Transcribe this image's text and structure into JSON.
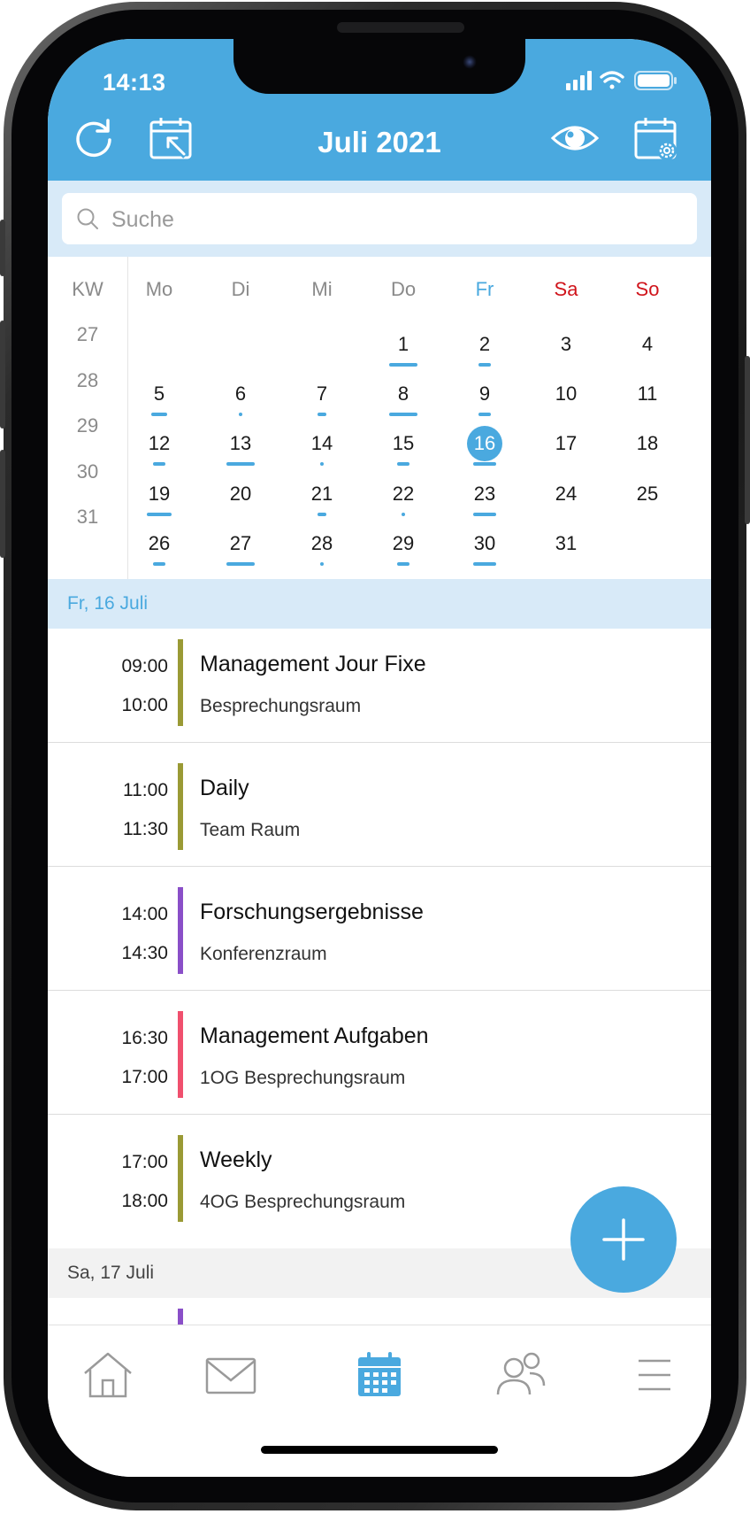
{
  "status_bar": {
    "time": "14:13"
  },
  "header": {
    "title": "Juli 2021"
  },
  "search": {
    "placeholder": "Suche"
  },
  "calendar": {
    "kw_label": "KW",
    "weekdays": [
      "Mo",
      "Di",
      "Mi",
      "Do",
      "Fr",
      "Sa",
      "So"
    ],
    "weeks": [
      {
        "kw": "27",
        "days": [
          "",
          "",
          "",
          "1",
          "2",
          "3",
          "4"
        ]
      },
      {
        "kw": "28",
        "days": [
          "5",
          "6",
          "7",
          "8",
          "9",
          "10",
          "11"
        ]
      },
      {
        "kw": "29",
        "days": [
          "12",
          "13",
          "14",
          "15",
          "16",
          "17",
          "18"
        ]
      },
      {
        "kw": "30",
        "days": [
          "19",
          "20",
          "21",
          "22",
          "23",
          "24",
          "25"
        ]
      },
      {
        "kw": "31",
        "days": [
          "26",
          "27",
          "28",
          "29",
          "30",
          "31",
          ""
        ]
      }
    ],
    "selected_day": "16"
  },
  "agenda": {
    "day1_label": "Fr, 16 Juli",
    "day2_label": "Sa, 17 Juli",
    "events": [
      {
        "start": "09:00",
        "end": "10:00",
        "title": "Management Jour Fixe",
        "location": "Besprechungsraum",
        "color": "#9a9a35"
      },
      {
        "start": "11:00",
        "end": "11:30",
        "title": "Daily",
        "location": "Team Raum",
        "color": "#9a9a35"
      },
      {
        "start": "14:00",
        "end": "14:30",
        "title": "Forschungsergebnisse",
        "location": "Konferenzraum",
        "color": "#8a4fc8"
      },
      {
        "start": "16:30",
        "end": "17:00",
        "title": "Management Aufgaben",
        "location": "1OG Besprechungsraum",
        "color": "#f0506e"
      },
      {
        "start": "17:00",
        "end": "18:00",
        "title": "Weekly",
        "location": "4OG Besprechungsraum",
        "color": "#9a9a35"
      }
    ]
  },
  "colors": {
    "accent": "#4aa9df",
    "friday_label": "#4aa9df",
    "weekend_label": "#d0141b",
    "selected_day_band": "#d8eaf8",
    "other_day_band": "#f2f2f2"
  },
  "tabbar": {
    "icons": [
      "home-icon",
      "mail-icon",
      "calendar-icon",
      "contacts-icon",
      "menu-icon"
    ],
    "active": "calendar-icon"
  }
}
